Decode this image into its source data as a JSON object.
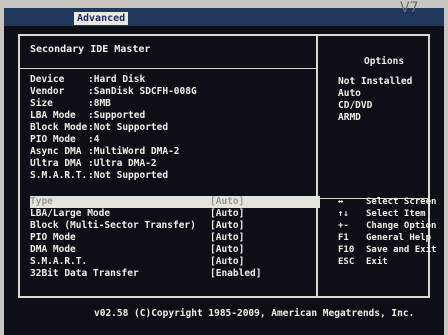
{
  "topbar": {
    "active_tab": "Advanced"
  },
  "section_title": "Secondary IDE Master",
  "right_panel": {
    "title": "Options",
    "choices": [
      "Not Installed",
      "Auto",
      "CD/DVD",
      "ARMD"
    ]
  },
  "device_info": [
    {
      "label": "Device",
      "value": ":Hard Disk"
    },
    {
      "label": "Vendor",
      "value": ":SanDisk SDCFH-008G"
    },
    {
      "label": "Size",
      "value": ":8MB"
    },
    {
      "label": "LBA Mode",
      "value": ":Supported"
    },
    {
      "label": "Block Mode",
      "value": ":Not Supported"
    },
    {
      "label": "PIO Mode",
      "value": ":4"
    },
    {
      "label": "Async DMA",
      "value": ":MultiWord DMA-2"
    },
    {
      "label": "Ultra DMA",
      "value": ":Ultra DMA-2"
    },
    {
      "label": "S.M.A.R.T.",
      "value": ":Not Supported"
    }
  ],
  "options": [
    {
      "label": "Type",
      "value": "[Auto]"
    },
    {
      "label": "LBA/Large Mode",
      "value": "[Auto]"
    },
    {
      "label": "Block (Multi-Sector Transfer)",
      "value": "[Auto]"
    },
    {
      "label": "PIO Mode",
      "value": "[Auto]"
    },
    {
      "label": "DMA Mode",
      "value": "[Auto]"
    },
    {
      "label": "S.M.A.R.T.",
      "value": "[Auto]"
    },
    {
      "label": "32Bit Data Transfer",
      "value": "[Enabled]"
    }
  ],
  "help": [
    {
      "key": "↔",
      "desc": "Select Screen"
    },
    {
      "key": "↑↓",
      "desc": "Select Item"
    },
    {
      "key": "+-",
      "desc": "Change Option"
    },
    {
      "key": "F1",
      "desc": "General Help"
    },
    {
      "key": "F10",
      "desc": "Save and Exit"
    },
    {
      "key": "ESC",
      "desc": "Exit"
    }
  ],
  "footer": "v02.58 (C)Copyright 1985-2009, American Megatrends, Inc.",
  "bezel_mark": "V7"
}
